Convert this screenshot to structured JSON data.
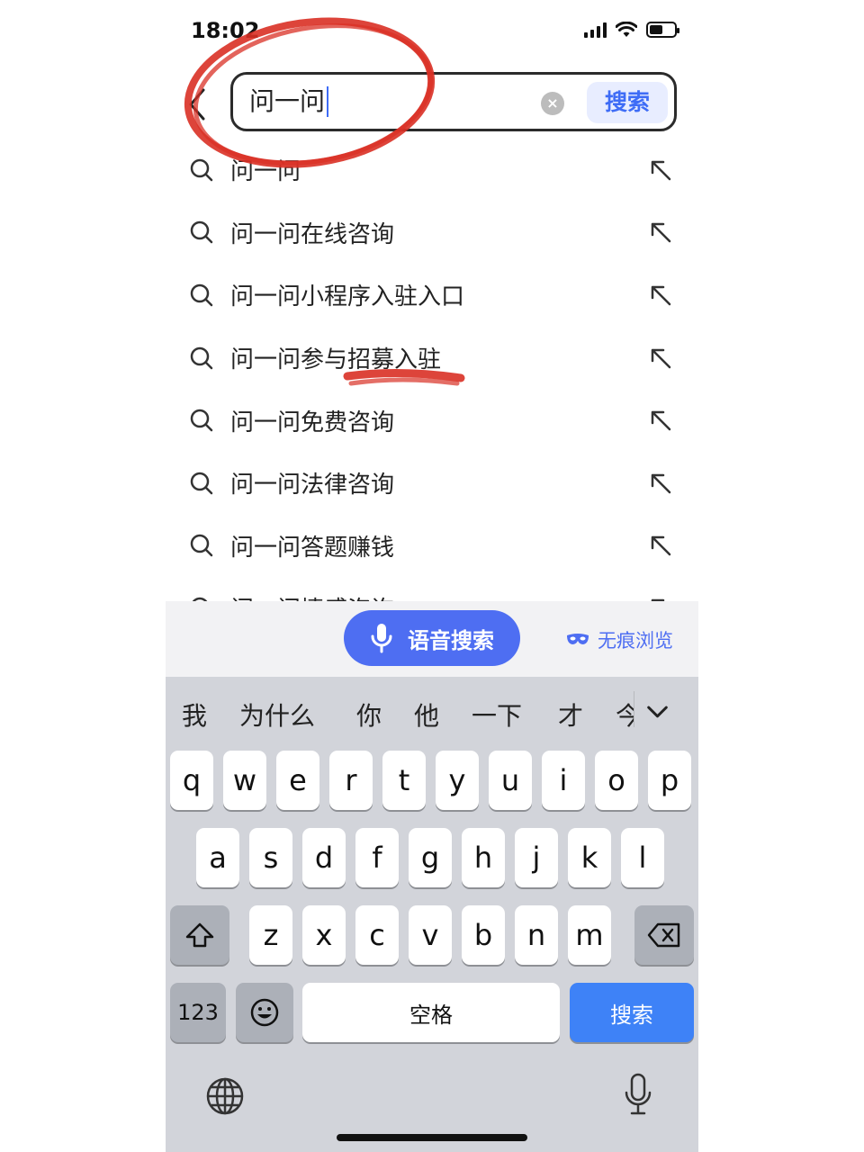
{
  "status_bar": {
    "time": "18:02"
  },
  "search": {
    "back_icon": "chevron-left-icon",
    "query": "问一问",
    "clear_icon": "clear-x-icon",
    "button": "搜索"
  },
  "suggestions": [
    {
      "text": "问一问"
    },
    {
      "text": "问一问在线咨询"
    },
    {
      "text": "问一问小程序入驻入口"
    },
    {
      "text": "问一问参与招募入驻"
    },
    {
      "text": "问一问免费咨询"
    },
    {
      "text": "问一问法律咨询"
    },
    {
      "text": "问一问答题赚钱"
    },
    {
      "text": "问一问情感咨询"
    }
  ],
  "toolbar": {
    "voice_search": "语音搜索",
    "incognito": "无痕浏览"
  },
  "keyboard": {
    "candidates": [
      "我",
      "为什么",
      "你",
      "他",
      "一下",
      "才",
      "今"
    ],
    "row1": [
      "q",
      "w",
      "e",
      "r",
      "t",
      "y",
      "u",
      "i",
      "o",
      "p"
    ],
    "row2": [
      "a",
      "s",
      "d",
      "f",
      "g",
      "h",
      "j",
      "k",
      "l"
    ],
    "row3": [
      "z",
      "x",
      "c",
      "v",
      "b",
      "n",
      "m"
    ],
    "numbers_key": "123",
    "space_key": "空格",
    "enter_key": "搜索"
  },
  "colors": {
    "accent": "#4e6ef2",
    "enter_key": "#3e82f7",
    "annotation_red": "#d93025"
  }
}
